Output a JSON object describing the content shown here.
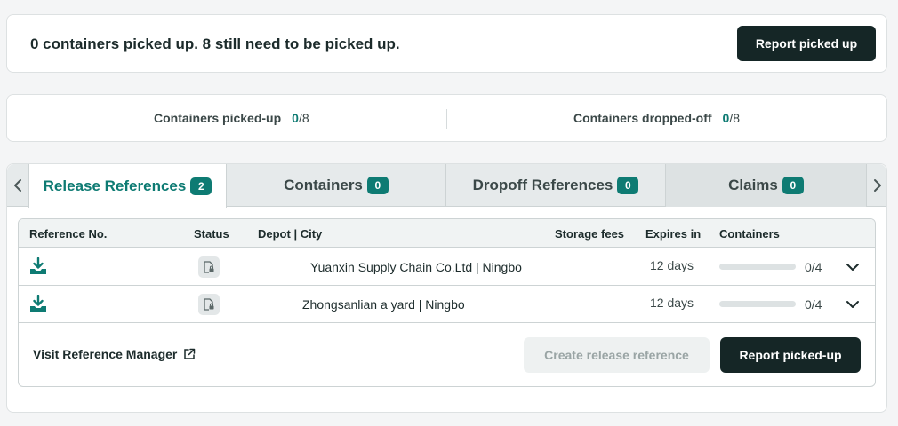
{
  "banner": {
    "message": "0 containers picked up. 8 still need to be picked up.",
    "button_label": "Report picked up"
  },
  "stats": {
    "picked_up": {
      "label": "Containers picked-up",
      "value": "0",
      "total": "/8"
    },
    "dropped_off": {
      "label": "Containers dropped-off",
      "value": "0",
      "total": "/8"
    }
  },
  "tabs": [
    {
      "label": "Release References",
      "count": "2"
    },
    {
      "label": "Containers",
      "count": "0"
    },
    {
      "label": "Dropoff References",
      "count": "0"
    },
    {
      "label": "Claims",
      "count": "0"
    }
  ],
  "table": {
    "headers": {
      "reference": "Reference No.",
      "status": "Status",
      "depot": "Depot | City",
      "storage": "Storage fees",
      "expires": "Expires in",
      "containers": "Containers"
    },
    "rows": [
      {
        "depot": "Yuanxin Supply Chain Co.Ltd | Ningbo",
        "expires": "12 days",
        "containers": "0/4",
        "progress": 0
      },
      {
        "depot": "Zhongsanlian a yard | Ningbo",
        "expires": "12 days",
        "containers": "0/4",
        "progress": 0
      }
    ]
  },
  "footer": {
    "visit_label": "Visit Reference Manager",
    "create_label": "Create release reference",
    "report_label": "Report picked-up"
  },
  "colors": {
    "accent": "#0e7b73",
    "dark_button": "#152626",
    "disabled_button": "#eef1f1"
  },
  "icons": {
    "download": "download-icon",
    "status": "document-lock-icon",
    "expand": "chevron-down-icon",
    "external": "external-link-icon",
    "tab_prev": "chevron-left-icon",
    "tab_next": "chevron-right-icon"
  }
}
